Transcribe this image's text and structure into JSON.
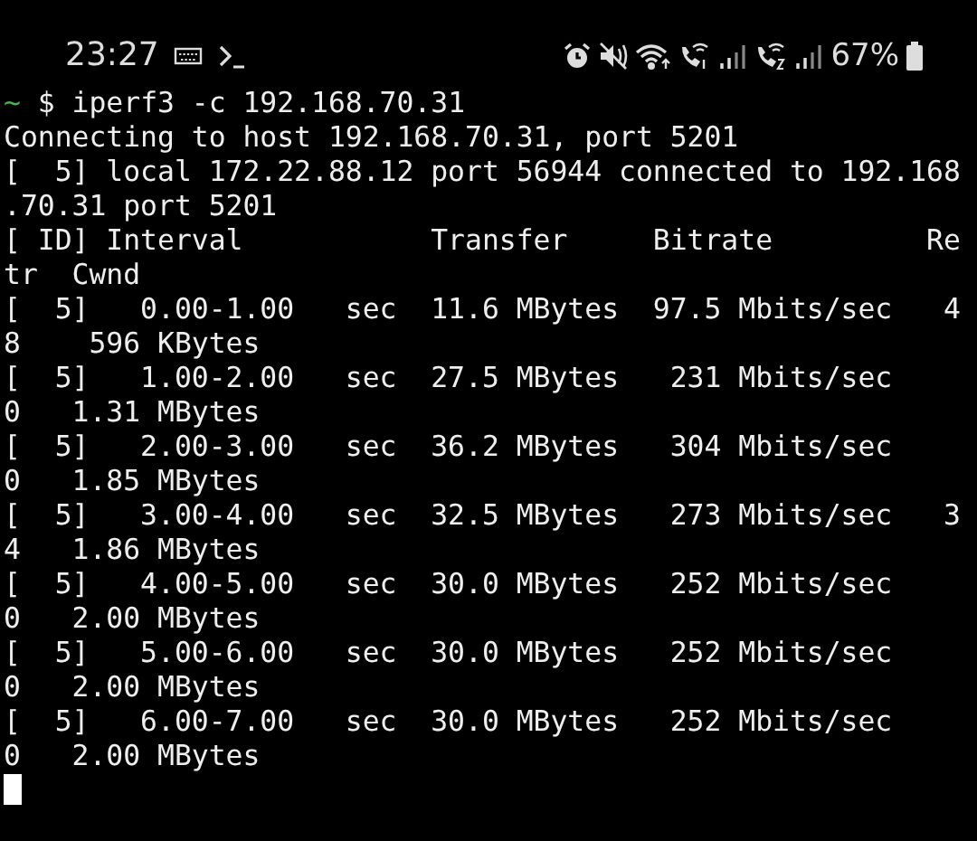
{
  "status_bar": {
    "time": "23:27",
    "battery": "67%"
  },
  "terminal": {
    "lines": [
      {
        "kind": "prompt",
        "prompt": "~",
        "text": "$ iperf3 -c 192.168.70.31"
      },
      {
        "kind": "output",
        "text": "Connecting to host 192.168.70.31, port 5201"
      },
      {
        "kind": "output",
        "text": "[  5] local 172.22.88.12 port 56944 connected to 192.168"
      },
      {
        "kind": "output",
        "text": ".70.31 port 5201"
      },
      {
        "kind": "output",
        "text": "[ ID] Interval           Transfer     Bitrate         Re"
      },
      {
        "kind": "output",
        "text": "tr  Cwnd"
      },
      {
        "kind": "output",
        "text": "[  5]   0.00-1.00   sec  11.6 MBytes  97.5 Mbits/sec   4"
      },
      {
        "kind": "output",
        "text": "8    596 KBytes"
      },
      {
        "kind": "output",
        "text": "[  5]   1.00-2.00   sec  27.5 MBytes   231 Mbits/sec"
      },
      {
        "kind": "output",
        "text": "0   1.31 MBytes"
      },
      {
        "kind": "output",
        "text": "[  5]   2.00-3.00   sec  36.2 MBytes   304 Mbits/sec"
      },
      {
        "kind": "output",
        "text": "0   1.85 MBytes"
      },
      {
        "kind": "output",
        "text": "[  5]   3.00-4.00   sec  32.5 MBytes   273 Mbits/sec   3"
      },
      {
        "kind": "output",
        "text": "4   1.86 MBytes"
      },
      {
        "kind": "output",
        "text": "[  5]   4.00-5.00   sec  30.0 MBytes   252 Mbits/sec"
      },
      {
        "kind": "output",
        "text": "0   2.00 MBytes"
      },
      {
        "kind": "output",
        "text": "[  5]   5.00-6.00   sec  30.0 MBytes   252 Mbits/sec"
      },
      {
        "kind": "output",
        "text": "0   2.00 MBytes"
      },
      {
        "kind": "output",
        "text": "[  5]   6.00-7.00   sec  30.0 MBytes   252 Mbits/sec"
      },
      {
        "kind": "output",
        "text": "0   2.00 MBytes"
      },
      {
        "kind": "cursor"
      }
    ]
  }
}
